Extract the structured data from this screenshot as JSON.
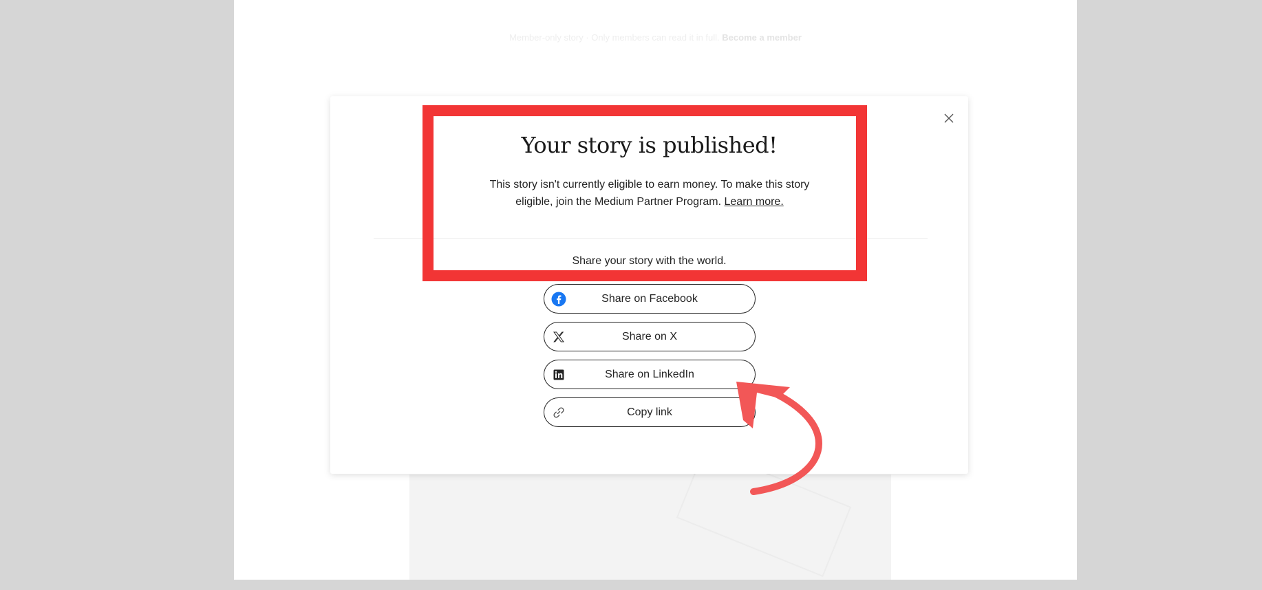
{
  "background_page": {
    "member_banner_text": "Member-only story · Only members can read it in full.",
    "member_banner_link": "Become a member"
  },
  "modal": {
    "title": "Your story is published!",
    "description": "This story isn't currently eligible to earn money. To make this story eligible, join the Medium Partner Program.",
    "learn_more": "Learn more.",
    "share_caption": "Share your story with the world.",
    "buttons": [
      {
        "label": "Share on Facebook",
        "icon": "facebook-icon"
      },
      {
        "label": "Share on X",
        "icon": "x-icon"
      },
      {
        "label": "Share on LinkedIn",
        "icon": "linkedin-icon"
      },
      {
        "label": "Copy link",
        "icon": "link-icon"
      }
    ],
    "close_icon": "close-icon"
  },
  "annotations": {
    "highlight_color": "#f23535",
    "arrow_color": "#f25757"
  },
  "colors": {
    "facebook": "#1877f2",
    "text": "#242424",
    "backdrop": "#d6d6d6"
  }
}
